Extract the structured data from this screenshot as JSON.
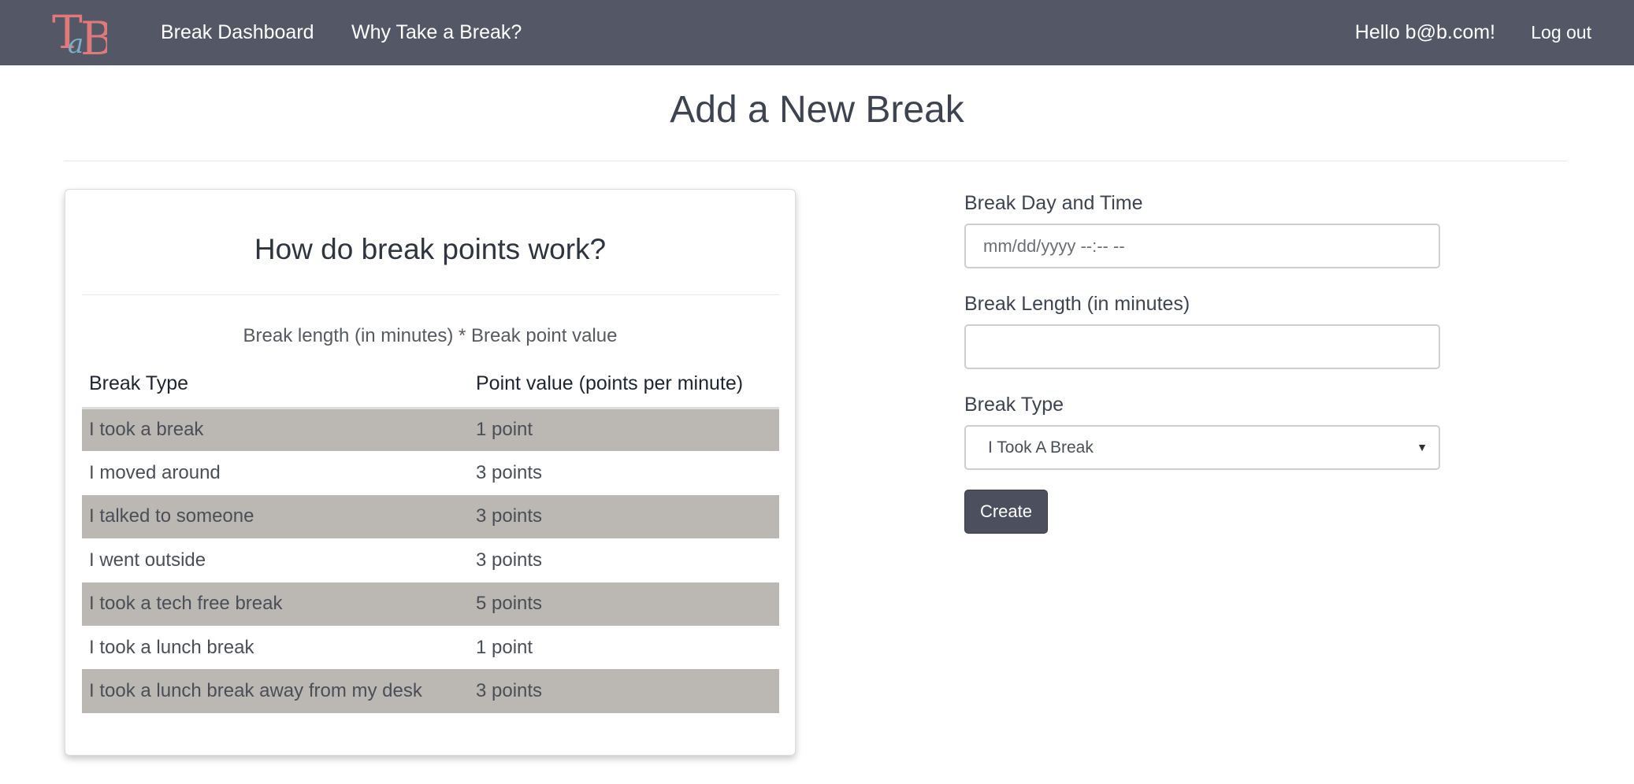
{
  "nav": {
    "logo_text": "TaB",
    "dashboard": "Break Dashboard",
    "why": "Why Take a Break?",
    "hello": "Hello b@b.com!",
    "logout": "Log out"
  },
  "page": {
    "title": "Add a New Break"
  },
  "info_card": {
    "title": "How do break points work?",
    "formula": "Break length (in minutes) * Break point value",
    "headers": [
      "Break Type",
      "Point value (points per minute)"
    ],
    "rows": [
      {
        "type": "I took a break",
        "points": "1 point"
      },
      {
        "type": "I moved around",
        "points": "3 points"
      },
      {
        "type": "I talked to someone",
        "points": "3 points"
      },
      {
        "type": "I went outside",
        "points": "3 points"
      },
      {
        "type": "I took a tech free break",
        "points": "5 points"
      },
      {
        "type": "I took a lunch break",
        "points": "1 point"
      },
      {
        "type": "I took a lunch break away from my desk",
        "points": "3 points"
      }
    ]
  },
  "form": {
    "day_label": "Break Day and Time",
    "day_placeholder": "mm/dd/yyyy --:-- --",
    "length_label": "Break Length (in minutes)",
    "length_value": "",
    "type_label": "Break Type",
    "type_selected": "I Took A Break",
    "create_label": "Create"
  },
  "colors": {
    "navbar": "#545766",
    "row_shade": "#bbb7b3",
    "button": "#4b4f5e",
    "logo_pink": "#e07a7a",
    "logo_blue": "#7ab0c9"
  }
}
